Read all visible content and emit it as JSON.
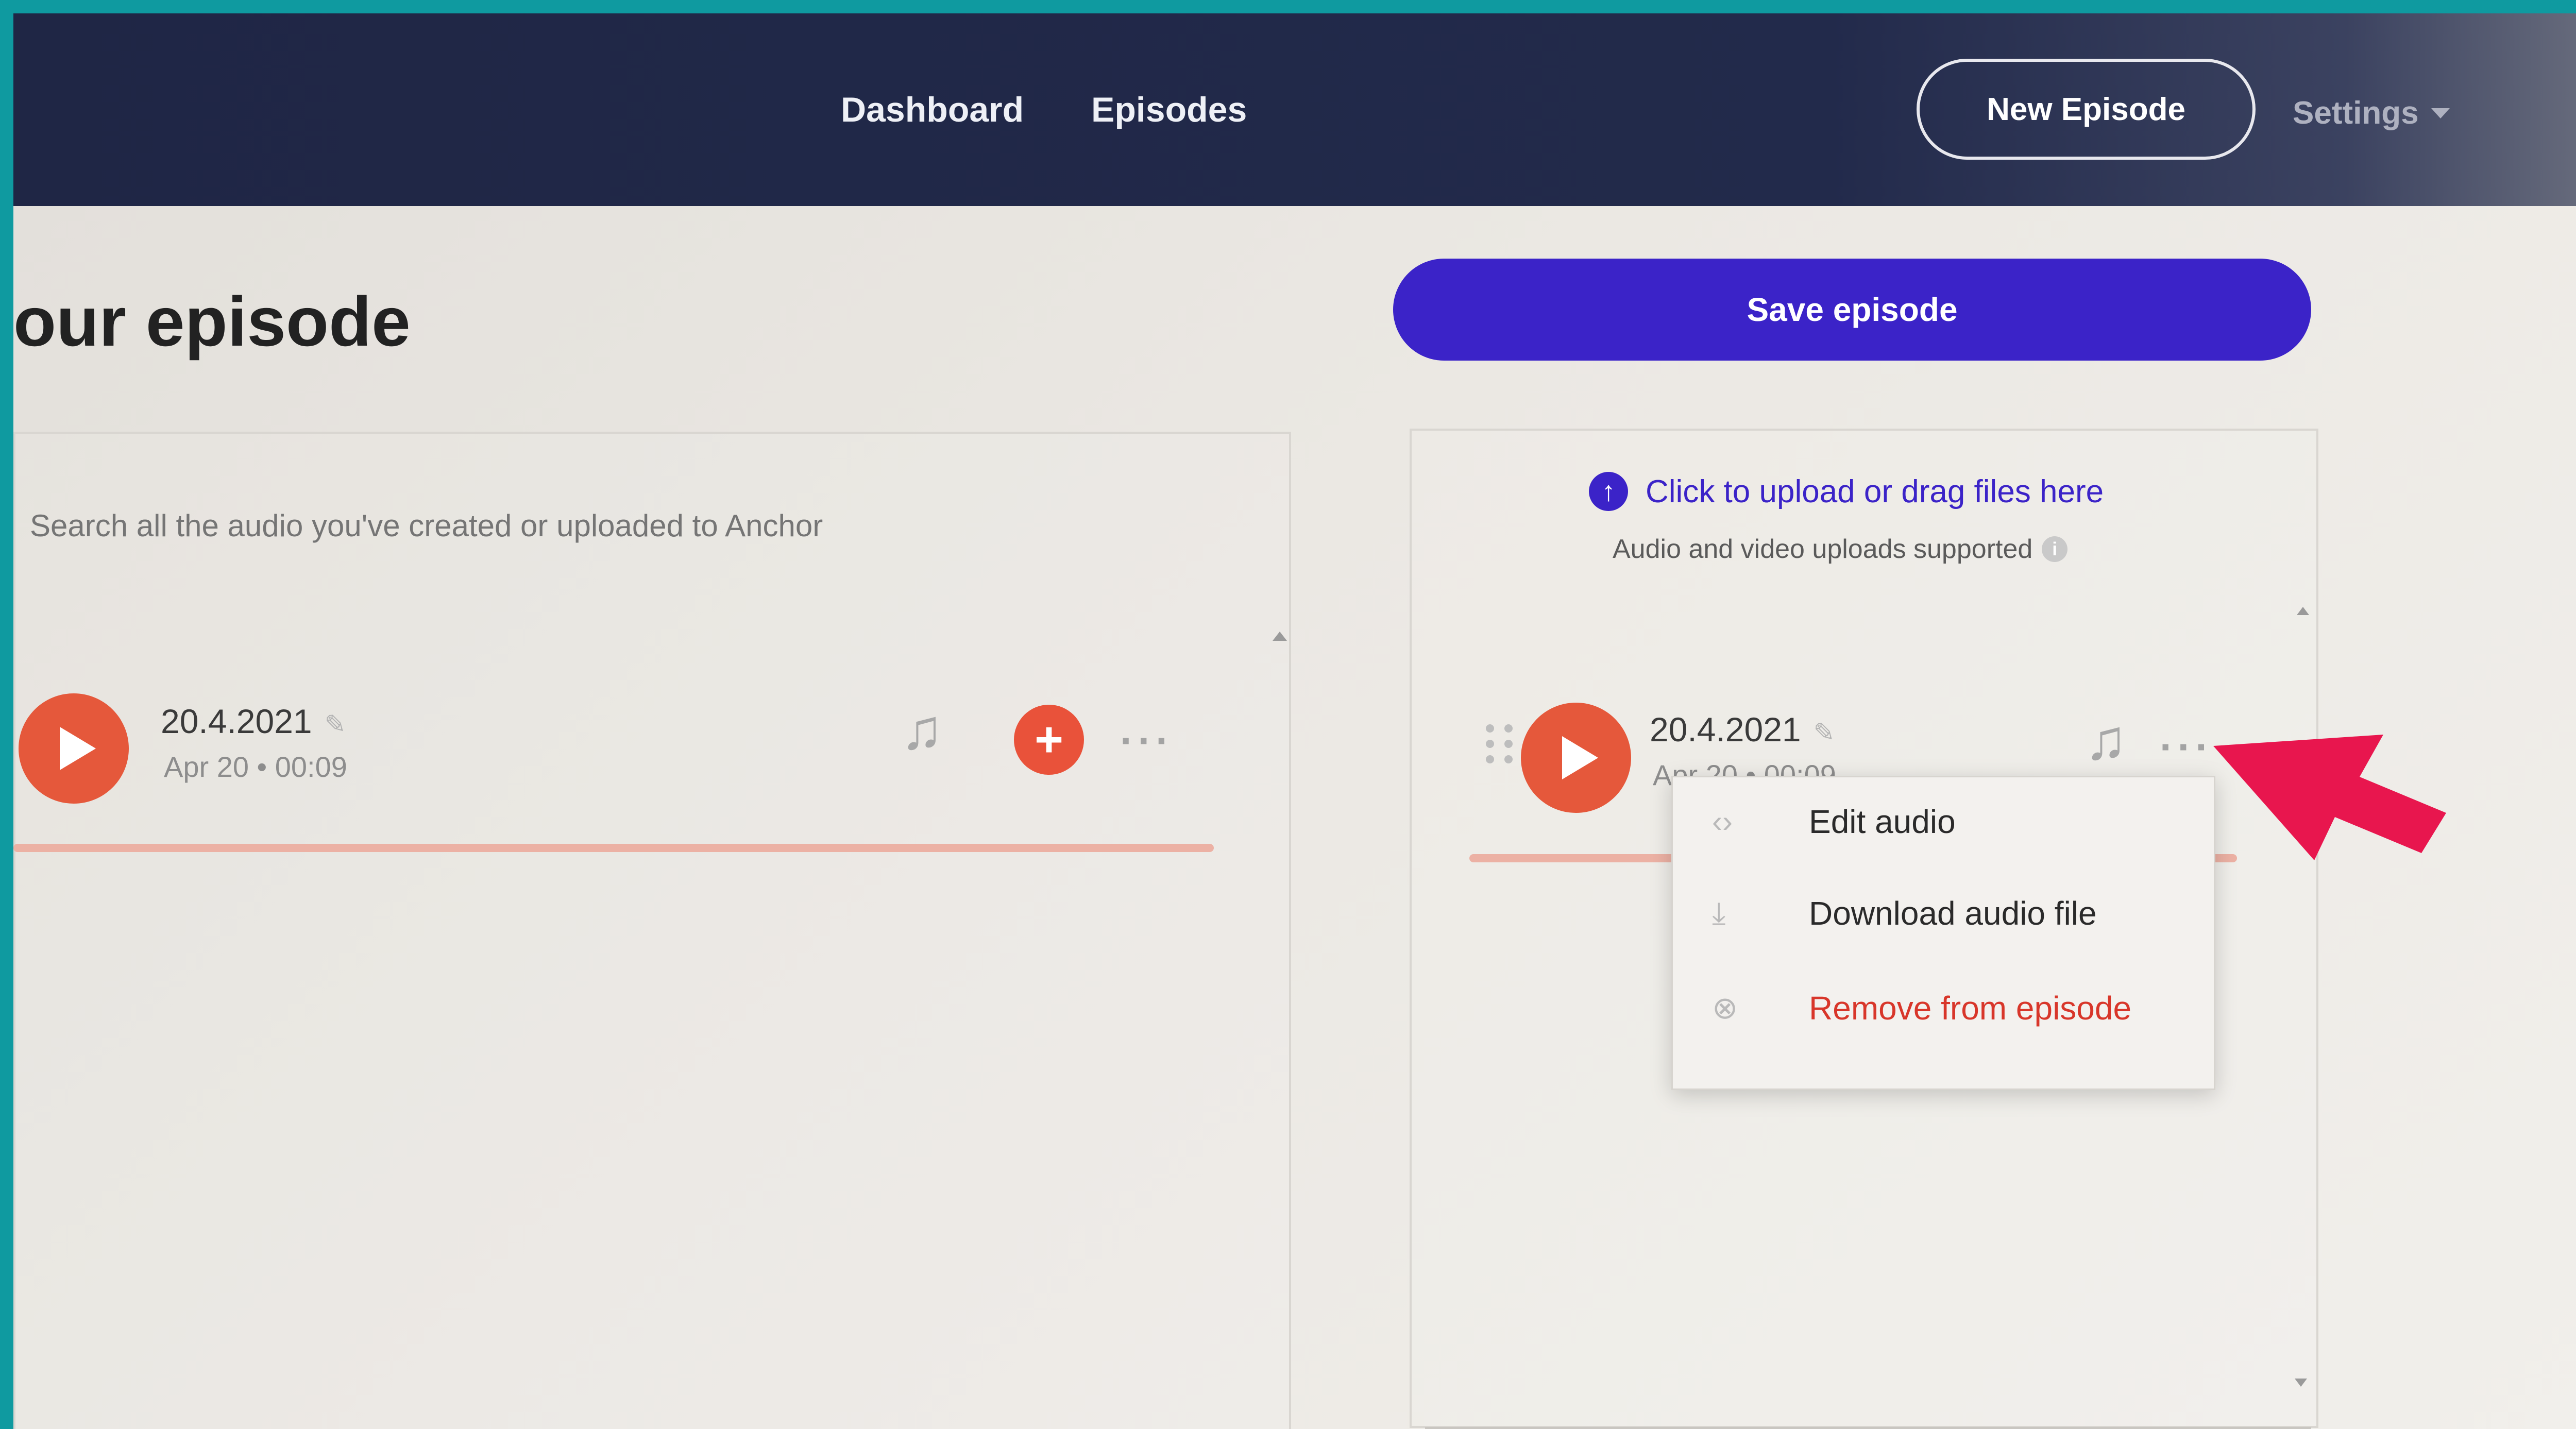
{
  "nav": {
    "dashboard": "Dashboard",
    "episodes": "Episodes",
    "new_episode": "New Episode",
    "settings": "Settings"
  },
  "page": {
    "title": "our episode",
    "save_button": "Save episode"
  },
  "library": {
    "search_placeholder": "Search all the audio you've created or uploaded to Anchor",
    "clip": {
      "title": "20.4.2021",
      "meta": "Apr 20 • 00:09"
    }
  },
  "episode": {
    "upload_link": "Click to upload or drag files here",
    "upload_note": "Audio and video uploads supported",
    "clip": {
      "title": "20.4.2021",
      "meta": "Apr 20 • 00:09"
    }
  },
  "menu": {
    "items": [
      {
        "label": "Edit audio",
        "icon": "code-brackets-icon"
      },
      {
        "label": "Download audio file",
        "icon": "download-icon"
      },
      {
        "label": "Remove from episode",
        "icon": "remove-circle-icon"
      }
    ]
  },
  "colors": {
    "accent": "#3b23c8",
    "play": "#e5583b",
    "danger": "#d8362a",
    "annotation": "#e8164e",
    "frame": "#0f9aa0",
    "navbar": "#1f2645"
  }
}
